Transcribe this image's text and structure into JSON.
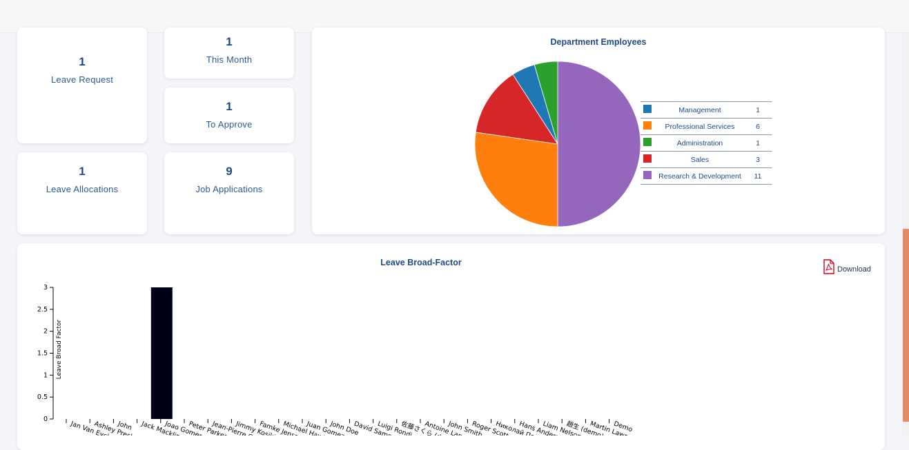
{
  "stats": {
    "leave_request": {
      "value": "1",
      "label": "Leave Request"
    },
    "this_month": {
      "value": "1",
      "label": "This Month"
    },
    "to_approve": {
      "value": "1",
      "label": "To Approve"
    },
    "leave_allocations": {
      "value": "1",
      "label": "Leave Allocations"
    },
    "job_applications": {
      "value": "9",
      "label": "Job Applications"
    }
  },
  "department_chart": {
    "title": "Department Employees",
    "legend": [
      {
        "label": "Management",
        "value": "1",
        "color": "#1f77b4"
      },
      {
        "label": "Professional Services",
        "value": "6",
        "color": "#ff7f0e"
      },
      {
        "label": "Administration",
        "value": "1",
        "color": "#2ca02c"
      },
      {
        "label": "Sales",
        "value": "3",
        "color": "#d62728"
      },
      {
        "label": "Research & Development",
        "value": "11",
        "color": "#9467bd"
      }
    ]
  },
  "broad_factor": {
    "title": "Leave Broad-Factor",
    "download_label": "Download",
    "ylabel": "Leave Broad Factor"
  },
  "chart_data": [
    {
      "type": "pie",
      "title": "Department Employees",
      "categories": [
        "Management",
        "Professional Services",
        "Administration",
        "Sales",
        "Research & Development"
      ],
      "values": [
        1,
        6,
        1,
        3,
        11
      ],
      "colors": [
        "#1f77b4",
        "#ff7f0e",
        "#2ca02c",
        "#d62728",
        "#9467bd"
      ],
      "legend": "right"
    },
    {
      "type": "bar",
      "title": "Leave Broad-Factor",
      "ylabel": "Leave Broad Factor",
      "ylim": [
        0,
        3
      ],
      "yticks": [
        "0",
        "0.5",
        "1",
        "1.5",
        "2",
        "2.5",
        "3"
      ],
      "categories": [
        "Jan Van Eyck",
        "Ashley Presley",
        "John",
        "Jack Macklin",
        "Joao Gomer",
        "Peter Parker",
        "Jean-Pierre C",
        "Jimmy Kosikin",
        "Famke Jenssen",
        "Michael Hawkins",
        "Juan Gomez",
        "John Doe",
        "David Samson",
        "Luigi Rondi",
        "佐藤さくら (demo)",
        "Antoine Langlais",
        "John Smith",
        "Roger Scott",
        "Николай Петров",
        "Hans Anders",
        "Liam Nelson",
        "趙生 (demo)",
        "Martin Lawrence",
        "Demo"
      ],
      "values": [
        0,
        0,
        0,
        0,
        3,
        0,
        0,
        0,
        0,
        0,
        0,
        0,
        0,
        0,
        0,
        0,
        0,
        0,
        0,
        0,
        0,
        0,
        0,
        0
      ],
      "bar_color": "#000016"
    }
  ]
}
